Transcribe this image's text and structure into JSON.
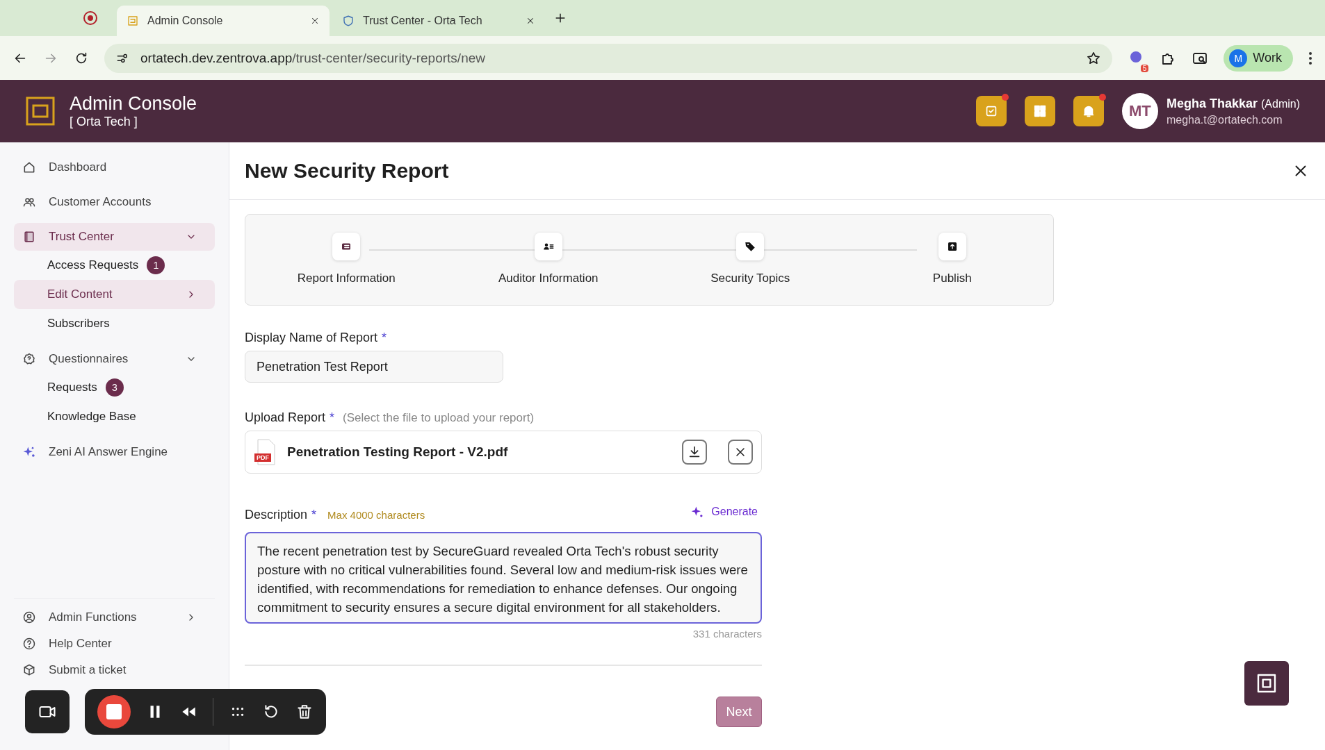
{
  "browser": {
    "tabs": [
      {
        "title": "Admin Console",
        "selected": true
      },
      {
        "title": "Trust Center - Orta Tech",
        "selected": false
      }
    ],
    "url_host": "ortatech.dev.zentrova.app",
    "url_path": "/trust-center/security-reports/new",
    "extension_badge": "5",
    "profile_initial": "M",
    "profile": "Work"
  },
  "header": {
    "title": "Admin Console",
    "org": "[ Orta Tech ]",
    "user_initials": "MT",
    "user_name": "Megha Thakkar",
    "user_role": "(Admin)",
    "user_email": "megha.t@ortatech.com"
  },
  "sidebar": {
    "items": [
      {
        "label": "Dashboard",
        "selected": false
      },
      {
        "label": "Customer Accounts",
        "selected": false
      },
      {
        "label": "Trust Center",
        "selected": true,
        "expanded": true,
        "children": [
          {
            "label": "Access Requests",
            "badge": "1",
            "selected": false
          },
          {
            "label": "Edit Content",
            "selected": true,
            "chevron": true
          },
          {
            "label": "Subscribers",
            "selected": false
          }
        ]
      },
      {
        "label": "Questionnaires",
        "selected": false,
        "expanded": true,
        "children": [
          {
            "label": "Requests",
            "badge": "3",
            "selected": false
          },
          {
            "label": "Knowledge Base",
            "selected": false
          }
        ]
      },
      {
        "label": "Zeni AI Answer Engine",
        "selected": false
      }
    ],
    "bottom_items": [
      {
        "label": "Admin Functions",
        "chevron": true
      },
      {
        "label": "Help Center"
      },
      {
        "label": "Submit a ticket"
      }
    ]
  },
  "page": {
    "title": "New Security Report",
    "steps": [
      {
        "label": "Report Information",
        "selected": true
      },
      {
        "label": "Auditor Information",
        "selected": false
      },
      {
        "label": "Security Topics",
        "selected": false
      },
      {
        "label": "Publish",
        "selected": false
      }
    ],
    "display_name": {
      "label": "Display Name of Report",
      "required": "*",
      "value": "Penetration Test Report"
    },
    "upload": {
      "label": "Upload Report",
      "required": "*",
      "hint": "(Select the file to upload your report)",
      "file_name": "Penetration Testing Report - V2.pdf",
      "file_type": "PDF"
    },
    "description": {
      "label": "Description",
      "required": "*",
      "limit": "Max 4000 characters",
      "generate": "Generate",
      "value": "The recent penetration test by SecureGuard revealed Orta Tech's robust security posture with no critical vulnerabilities found. Several low and medium-risk issues were identified, with recommendations for remediation to enhance defenses. Our ongoing commitment to security ensures a secure digital environment for all stakeholders.",
      "count": "331 characters"
    },
    "next_button": {
      "label": "Next",
      "disabled": true
    }
  }
}
